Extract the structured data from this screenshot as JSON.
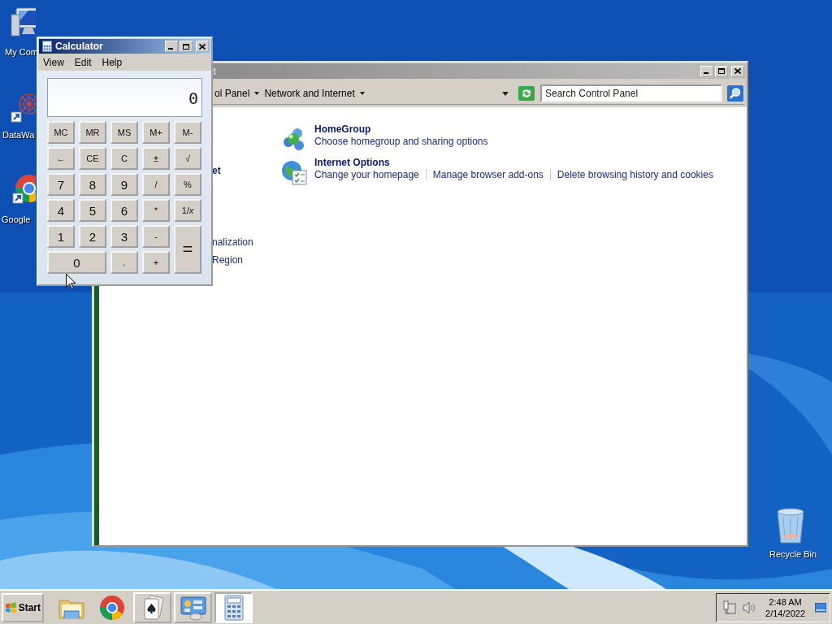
{
  "desktop_icons": [
    {
      "label": "My Com",
      "kind": "computer"
    },
    {
      "label": "DataWa",
      "kind": "datawave"
    },
    {
      "label": "Google",
      "kind": "chrome"
    },
    {
      "label": "Recycle Bin",
      "kind": "recycle"
    }
  ],
  "control_panel": {
    "title": "t",
    "breadcrumb": [
      "ol Panel",
      "Network and Internet"
    ],
    "search": {
      "placeholder": "Search Control Panel"
    },
    "nav": [
      {
        "label": "et",
        "kind": "current"
      },
      {
        "label": "nalization",
        "kind": "link"
      },
      {
        "label": "Region",
        "kind": "link"
      }
    ],
    "categories": [
      {
        "title": "HomeGroup",
        "kind": "homegroup",
        "links": [
          "Choose homegroup and sharing options"
        ]
      },
      {
        "title": "Internet Options",
        "kind": "internet",
        "links": [
          "Change your homepage",
          "Manage browser add-ons",
          "Delete browsing history and cookies"
        ]
      }
    ]
  },
  "calculator": {
    "title": "Calculator",
    "menu": [
      "View",
      "Edit",
      "Help"
    ],
    "display": "0",
    "buttons": [
      {
        "label": "MC",
        "kind": "key"
      },
      {
        "label": "MR",
        "kind": "key"
      },
      {
        "label": "MS",
        "kind": "key"
      },
      {
        "label": "M+",
        "kind": "key"
      },
      {
        "label": "M-",
        "kind": "key"
      },
      {
        "label": "←",
        "kind": "key"
      },
      {
        "label": "CE",
        "kind": "key"
      },
      {
        "label": "C",
        "kind": "key"
      },
      {
        "label": "±",
        "kind": "key"
      },
      {
        "label": "√",
        "kind": "key"
      },
      {
        "label": "7",
        "kind": "digit"
      },
      {
        "label": "8",
        "kind": "digit"
      },
      {
        "label": "9",
        "kind": "digit"
      },
      {
        "label": "/",
        "kind": "key"
      },
      {
        "label": "%",
        "kind": "key"
      },
      {
        "label": "4",
        "kind": "digit"
      },
      {
        "label": "5",
        "kind": "digit"
      },
      {
        "label": "6",
        "kind": "digit"
      },
      {
        "label": "*",
        "kind": "key"
      },
      {
        "label": "1/*x*",
        "kind": "key"
      },
      {
        "label": "1",
        "kind": "digit"
      },
      {
        "label": "2",
        "kind": "digit"
      },
      {
        "label": "3",
        "kind": "digit"
      },
      {
        "label": "-",
        "kind": "key"
      },
      {
        "label": "=",
        "kind": "tall"
      },
      {
        "label": "0",
        "kind": "wide"
      },
      {
        "label": ".",
        "kind": "key"
      },
      {
        "label": "+",
        "kind": "key"
      }
    ]
  },
  "taskbar": {
    "start": "Start",
    "apps": [
      {
        "kind": "folder",
        "running": false,
        "selected": false
      },
      {
        "kind": "chrome",
        "running": false,
        "selected": false
      },
      {
        "kind": "cards",
        "running": true,
        "selected": false
      },
      {
        "kind": "controlpanel",
        "running": true,
        "selected": false
      },
      {
        "kind": "calculator",
        "running": true,
        "selected": true
      }
    ],
    "time": "2:48 AM",
    "date": "2/14/2022"
  }
}
